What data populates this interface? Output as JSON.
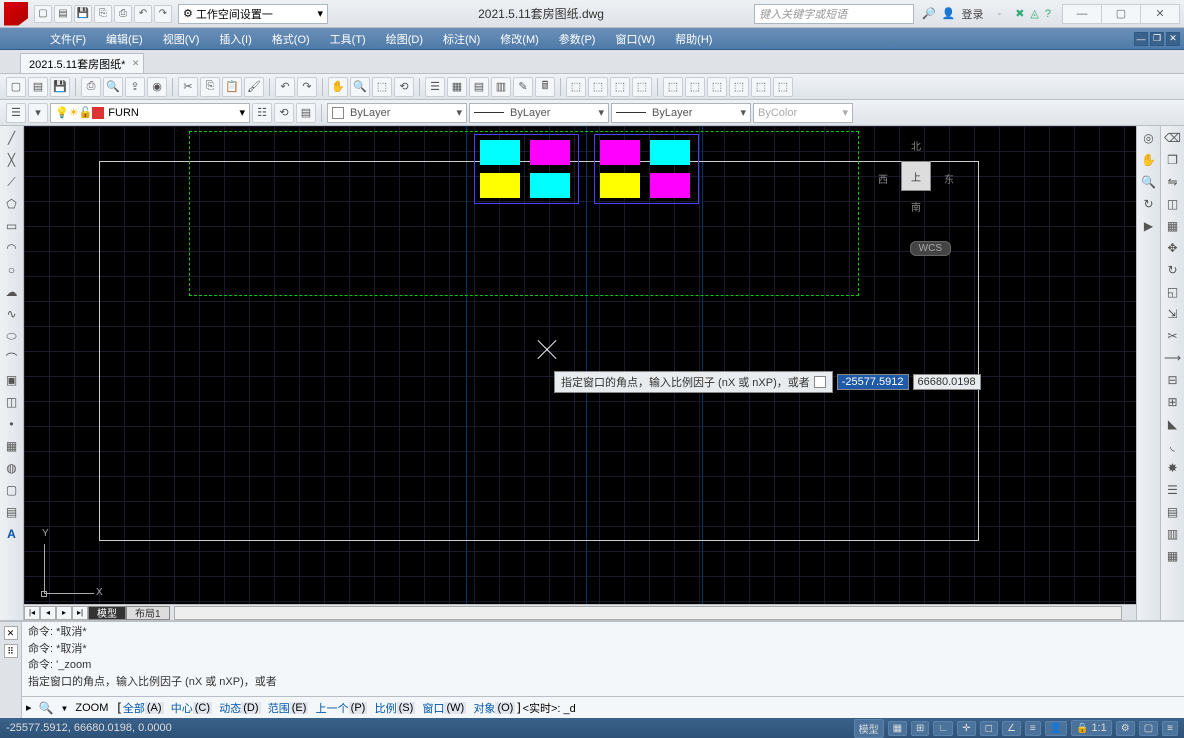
{
  "titlebar": {
    "workspace_label": "工作空间设置一",
    "filename": "2021.5.11套房图纸.dwg",
    "search_placeholder": "键入关键字或短语",
    "login_label": "登录"
  },
  "menu": {
    "file": "文件(F)",
    "edit": "编辑(E)",
    "view": "视图(V)",
    "insert": "插入(I)",
    "format": "格式(O)",
    "tools": "工具(T)",
    "draw": "绘图(D)",
    "dim": "标注(N)",
    "modify": "修改(M)",
    "param": "参数(P)",
    "window": "窗口(W)",
    "help": "帮助(H)"
  },
  "tab": {
    "name": "2021.5.11套房图纸*"
  },
  "layer": {
    "current": "FURN"
  },
  "props": {
    "color": "ByLayer",
    "ltype": "ByLayer",
    "lweight": "ByLayer",
    "plot": "ByColor"
  },
  "viewtabs": {
    "model": "模型",
    "layout1": "布局1"
  },
  "nav": {
    "n": "北",
    "s": "南",
    "e": "东",
    "w": "西",
    "top": "上",
    "wcs": "WCS"
  },
  "tooltip": {
    "text": "指定窗口的角点，输入比例因子 (nX 或 nXP)，或者",
    "val1": "-25577.5912",
    "val2": "66680.0198"
  },
  "cmd": {
    "l1": "命令: *取消*",
    "l2": "命令: *取消*",
    "l3": "命令: '_zoom",
    "l4": "指定窗口的角点，输入比例因子 (nX 或 nXP)，或者",
    "prompt_head": "ZOOM",
    "opts": {
      "all": "全部",
      "all_k": "(A)",
      "center": "中心",
      "center_k": "(C)",
      "dyn": "动态",
      "dyn_k": "(D)",
      "ext": "范围",
      "ext_k": "(E)",
      "prev": "上一个",
      "prev_k": "(P)",
      "scale": "比例",
      "scale_k": "(S)",
      "win": "窗口",
      "win_k": "(W)",
      "obj": "对象",
      "obj_k": "(O)"
    },
    "tail": " <实时>: _d"
  },
  "status": {
    "coords": "-25577.5912, 66680.0198, 0.0000",
    "model": "模型",
    "scale": "1:1"
  }
}
